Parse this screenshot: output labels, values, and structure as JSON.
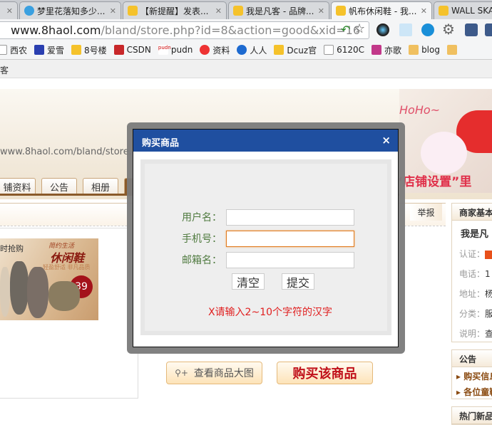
{
  "browser": {
    "tabs": [
      {
        "label": "梦里花落知多少..."
      },
      {
        "label": "【新提醒】发表..."
      },
      {
        "label": "我是凡客 - 品牌..."
      },
      {
        "label": "帆布休闲鞋 - 我...",
        "active": true
      },
      {
        "label": "WALL SKA"
      }
    ],
    "url_host": "www.8haol.com",
    "url_path": "/bland/store.php?id=8&action=good&xid=16",
    "bookmarks": [
      "西农",
      "爱雪",
      "8号楼",
      "CSDN",
      "pudn",
      "资料",
      "人人",
      "Dcuz官",
      "6120C",
      "亦歌",
      "blog"
    ],
    "title_fragment": "客"
  },
  "page": {
    "banner_url": "www.8haol.com/bland/store.php",
    "banner_promo": "“店铺设置”里",
    "banner_hoho": "HoHo~",
    "nav_tabs": [
      "铺资料",
      "公告",
      "相册"
    ],
    "report": "举报",
    "shoe_ad": {
      "left": "时抢购",
      "slogan": "简约生活",
      "title": "休闲鞋",
      "sub": "轻盈舒适 非凡品质",
      "price": "39"
    },
    "view_large_button": "查看商品大图",
    "buy_button": "购买该商品",
    "sidebar": {
      "merchant_title": "商家基本",
      "merchant_name": "我是凡",
      "rows": [
        {
          "label": "认证：",
          "value": ""
        },
        {
          "label": "电话：",
          "value": "1"
        },
        {
          "label": "地址：",
          "value": "杨"
        },
        {
          "label": "分类：",
          "value": "服"
        },
        {
          "label": "说明：",
          "value": "查"
        }
      ],
      "notice_title": "公告",
      "notices": [
        "购买信息",
        "各位童鞋"
      ],
      "hot_title": "热门新品"
    }
  },
  "dialog": {
    "title": "购买商品",
    "close": "×",
    "fields": [
      {
        "label": "用户名：",
        "value": ""
      },
      {
        "label": "手机号：",
        "value": ""
      },
      {
        "label": "邮箱名：",
        "value": ""
      }
    ],
    "clear_button": "清空",
    "submit_button": "提交",
    "error": "X请输入2~10个字符的汉字"
  }
}
